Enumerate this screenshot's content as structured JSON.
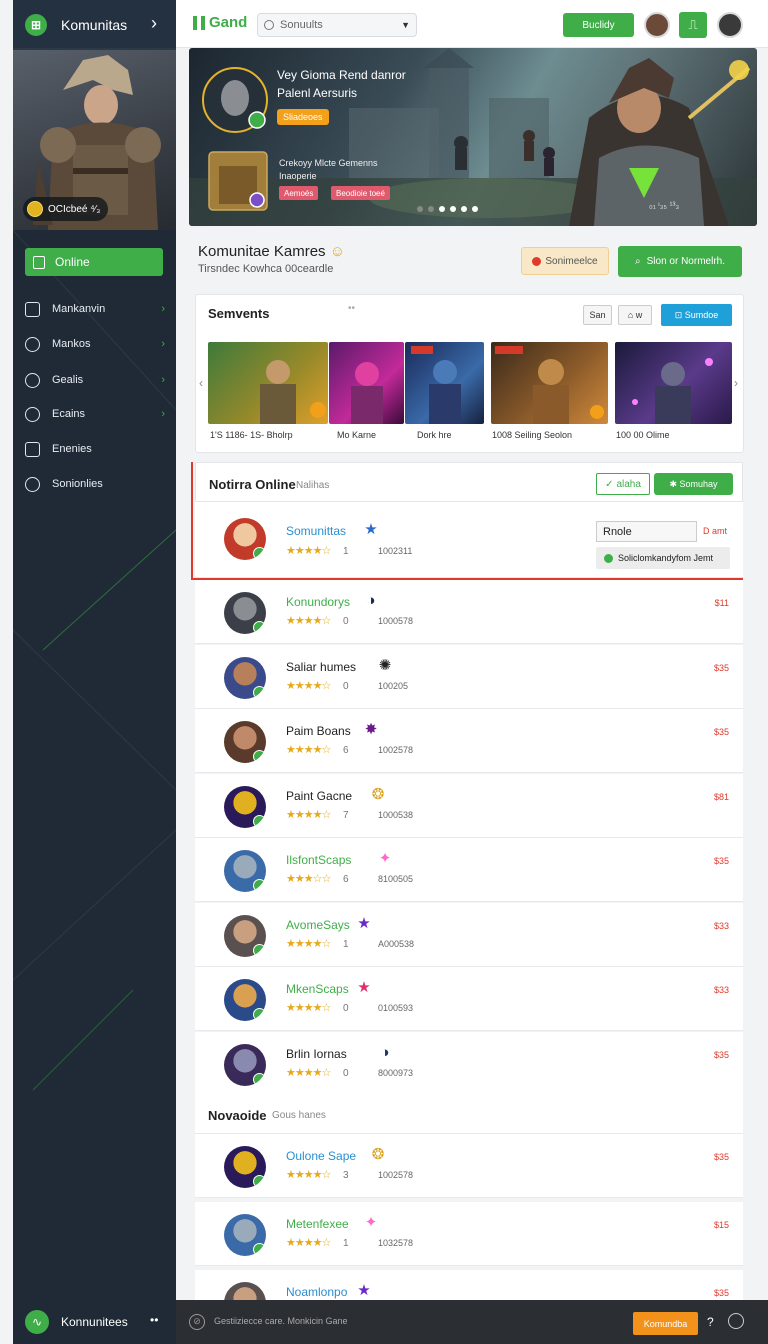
{
  "sidebar": {
    "title": "Komunitas",
    "hero_badge": "OCIcbeé  ⁴⁄₃",
    "nav_active": "Online",
    "items": [
      {
        "label": "Mankanvin",
        "icon": "square-icon"
      },
      {
        "label": "Mankos",
        "icon": "check-circle-icon"
      },
      {
        "label": "Gealis",
        "icon": "edit-icon"
      },
      {
        "label": "Ecains",
        "icon": "settings-icon"
      },
      {
        "label": "Enenies",
        "icon": "folder-icon"
      },
      {
        "label": "Sonionlies",
        "icon": "globe-icon"
      }
    ]
  },
  "topbar": {
    "brand": "Gand",
    "search_value": "Sonuults",
    "button_label": "Buclidy"
  },
  "banner": {
    "title_line1": "Vey Gioma Rend danror",
    "title_line2": "Palenl Aersuris",
    "tag": "Sliadeoes",
    "sub_line1": "Crekoyy Mlcte Gemenns",
    "sub_line2": "Inaoperie",
    "chip1": "Aemoés",
    "chip2": "Beodioie toeé",
    "counter": "₀₁  ᶦ₃₅  ¹³₃"
  },
  "community": {
    "title": "Komunitae Kamres",
    "subtitle": "Tirsndec Kowhca 00ceardle",
    "btn_secondary": "Sonimeelce",
    "btn_primary": "Slon or Normelrh."
  },
  "servers": {
    "title": "Semvents",
    "ctrl_san": "San",
    "ctrl_w": "w",
    "btn_blue": "Sumdoe",
    "tiles": [
      {
        "label": "1'S 1186- 1S- Bholrp"
      },
      {
        "label": "Mo Karne"
      },
      {
        "label": "Dork hre"
      },
      {
        "label": "1008 Seiling Seolon"
      },
      {
        "label": "100 00 Olime"
      }
    ]
  },
  "online": {
    "title": "Notirra Online",
    "subtitle": "Nalihas",
    "filter1": "alaha",
    "filter2": "Somuhay",
    "field_value": "Rnole",
    "field_suffix": "D amt",
    "status_label": "Soliclomkandyfom Jemt",
    "users": [
      {
        "name": "Somunittas",
        "rating": 4,
        "score": "1",
        "id": "1002311",
        "price": "",
        "name_color": "#2a8fd0"
      },
      {
        "name": "Konundorys",
        "rating": 4,
        "score": "0",
        "id": "1000578",
        "price": "$11",
        "name_color": "#3fae49"
      },
      {
        "name": "Saliar humes",
        "rating": 4,
        "score": "0",
        "id": "100205",
        "price": "$35",
        "name_color": "#222"
      },
      {
        "name": "Paim Boans",
        "rating": 4,
        "score": "6",
        "id": "1002578",
        "price": "$35",
        "name_color": "#222"
      },
      {
        "name": "Paint Gacne",
        "rating": 4,
        "score": "7",
        "id": "1000538",
        "price": "$81",
        "name_color": "#222"
      },
      {
        "name": "IlsfontScaps",
        "rating": 3,
        "score": "6",
        "id": "8100505",
        "price": "$35",
        "name_color": "#3fae49"
      },
      {
        "name": "AvomeSays",
        "rating": 4,
        "score": "1",
        "id": "A000538",
        "price": "$33",
        "name_color": "#3fae49"
      },
      {
        "name": "MkenScaps",
        "rating": 4,
        "score": "0",
        "id": "0100593",
        "price": "$33",
        "name_color": "#3fae49"
      },
      {
        "name": "Brlin Iornas",
        "rating": 4,
        "score": "0",
        "id": "8000973",
        "price": "$35",
        "name_color": "#222"
      }
    ]
  },
  "novaoide": {
    "title": "Novaoide",
    "subtitle": "Gous hanes",
    "users": [
      {
        "name": "Oulone Sape",
        "rating": 4,
        "score": "3",
        "id": "1002578",
        "price": "$35",
        "name_color": "#2a8fd0"
      },
      {
        "name": "Metenfexee",
        "rating": 4,
        "score": "1",
        "id": "1032578",
        "price": "$15",
        "name_color": "#3fae49"
      },
      {
        "name": "Noamlonpo",
        "rating": 4,
        "score": "",
        "id": "",
        "price": "$35",
        "name_color": "#2a8fd0"
      }
    ]
  },
  "footer": {
    "community_label": "Konnunitees",
    "status_text": "Gestiiziecce care. Monkicin Gane",
    "orange_btn": "Komundba",
    "help": "?"
  }
}
